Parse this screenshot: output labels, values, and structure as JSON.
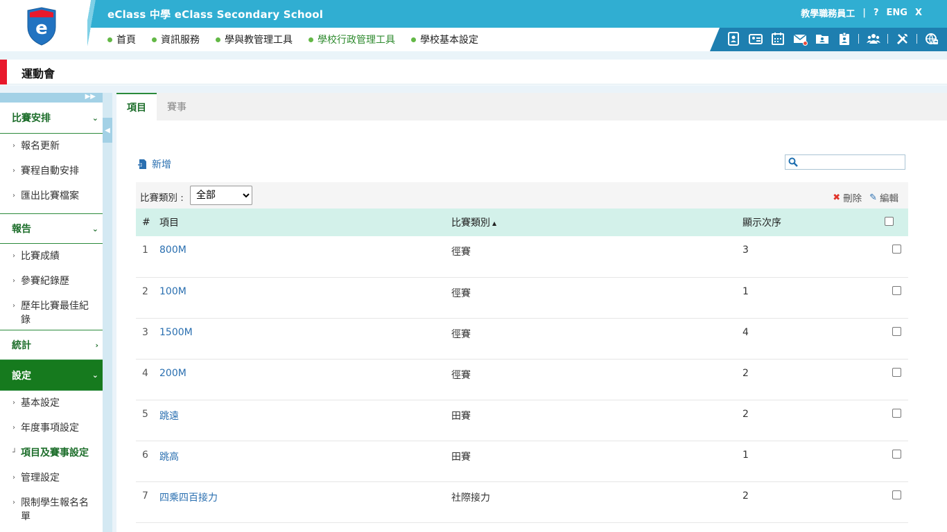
{
  "header": {
    "school_name": "eClass 中學 eClass Secondary School",
    "user_role": "教學職務員工",
    "help": "?",
    "language": "ENG",
    "close": "X",
    "nav": [
      {
        "label": "首頁",
        "active": false
      },
      {
        "label": "資訊服務",
        "active": false
      },
      {
        "label": "學與教管理工具",
        "active": false
      },
      {
        "label": "學校行政管理工具",
        "active": true
      },
      {
        "label": "學校基本設定",
        "active": false
      }
    ],
    "icons": [
      "ipad-portfolio-icon",
      "student-id-icon",
      "calendar-icon",
      "mail-icon",
      "folder-user-icon",
      "badge-icon",
      "group-icon",
      "tools-icon",
      "logout-globe-icon"
    ]
  },
  "page": {
    "title": "運動會"
  },
  "sidebar": {
    "sections": [
      {
        "label": "比賽安排",
        "items": [
          "報名更新",
          "賽程自動安排",
          "匯出比賽檔案"
        ]
      },
      {
        "label": "報告",
        "items": [
          "比賽成績",
          "參賽紀錄歷",
          "歷年比賽最佳紀錄"
        ]
      },
      {
        "label": "統計",
        "items": []
      },
      {
        "label": "設定",
        "items": [
          "基本設定",
          "年度事項設定",
          "項目及賽事設定",
          "管理設定",
          "限制學生報名名單"
        ]
      }
    ]
  },
  "main": {
    "tabs": [
      "項目",
      "賽事"
    ],
    "add_label": "新增",
    "search_placeholder": "",
    "filter_label": "比賽類別 :",
    "filter_value": "全部",
    "delete_label": "刪除",
    "edit_label": "編輯",
    "table": {
      "headers": [
        "#",
        "項目",
        "比賽類別",
        "顯示次序"
      ],
      "rows": [
        {
          "n": "1",
          "item": "800M",
          "category": "徑賽",
          "order": "3"
        },
        {
          "n": "2",
          "item": "100M",
          "category": "徑賽",
          "order": "1"
        },
        {
          "n": "3",
          "item": "1500M",
          "category": "徑賽",
          "order": "4"
        },
        {
          "n": "4",
          "item": "200M",
          "category": "徑賽",
          "order": "2"
        },
        {
          "n": "5",
          "item": "跳遠",
          "category": "田賽",
          "order": "2"
        },
        {
          "n": "6",
          "item": "跳高",
          "category": "田賽",
          "order": "1"
        },
        {
          "n": "7",
          "item": "四乘四百接力",
          "category": "社際接力",
          "order": "2"
        }
      ]
    }
  },
  "colors": {
    "header_blue": "#30aed2",
    "icon_bar": "#1e7fb0",
    "green": "#167a1e",
    "red_accent": "#e8192c",
    "table_head": "#d3f1ea"
  }
}
